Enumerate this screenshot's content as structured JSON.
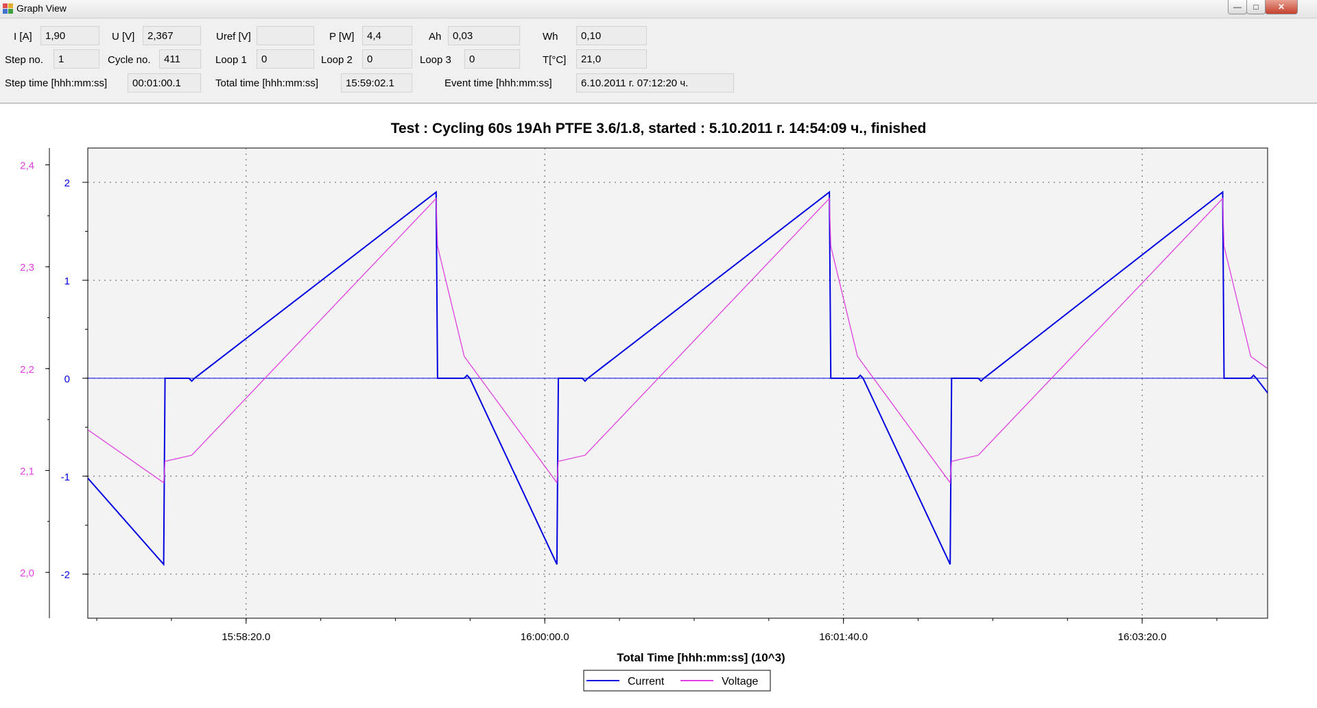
{
  "window": {
    "title": "Graph View",
    "icon": "graph-view-app-icon",
    "controls": {
      "minimize": "—",
      "maximize": "□",
      "close": "✕"
    }
  },
  "fields": {
    "current": {
      "label": "I [A]",
      "value": "1,90"
    },
    "voltage": {
      "label": "U [V]",
      "value": "2,367"
    },
    "uref": {
      "label": "Uref [V]",
      "value": ""
    },
    "power": {
      "label": "P [W]",
      "value": "4,4"
    },
    "ah": {
      "label": "Ah",
      "value": "0,03"
    },
    "wh": {
      "label": "Wh",
      "value": "0,10"
    },
    "step_no": {
      "label": "Step no.",
      "value": "1"
    },
    "cycle_no": {
      "label": "Cycle no.",
      "value": "411"
    },
    "loop1": {
      "label": "Loop 1",
      "value": "0"
    },
    "loop2": {
      "label": "Loop 2",
      "value": "0"
    },
    "loop3": {
      "label": "Loop 3",
      "value": "0"
    },
    "temperature": {
      "label": "T[°C]",
      "value": "21,0"
    },
    "step_time": {
      "label": "Step time [hhh:mm:ss]",
      "value": "00:01:00.1"
    },
    "total_time": {
      "label": "Total time [hhh:mm:ss]",
      "value": "15:59:02.1"
    },
    "event_time": {
      "label": "Event time [hhh:mm:ss]",
      "value": "6.10.2011 г. 07:12:20 ч."
    }
  },
  "chart_data": {
    "type": "line",
    "title": "Test : Cycling 60s 19Ah PTFE 3.6/1.8, started : 5.10.2011 г. 14:54:09 ч., finished",
    "xlabel": "Total Time [hhh:mm:ss] (10^3)",
    "x_ticks": [
      "15:58:20.0",
      "16:00:00.0",
      "16:01:40.0",
      "16:03:20.0"
    ],
    "x_tick_seconds": [
      57500,
      57600,
      57700,
      57800
    ],
    "xlim_seconds": [
      57447,
      57842
    ],
    "y_left_ticks": [
      "2,4",
      "2,3",
      "2,2",
      "2,1",
      "2,0"
    ],
    "y_left_values": [
      2.4,
      2.3,
      2.2,
      2.1,
      2.0
    ],
    "ylim_left": [
      1.955,
      2.4165
    ],
    "y_right_ticks": [
      "2",
      "1",
      "0",
      "-1",
      "-2"
    ],
    "y_right_values": [
      2,
      1,
      0,
      -1,
      -2
    ],
    "ylim_right": [
      -2.45,
      2.35
    ],
    "grid": true,
    "legend_position": "bottom-center",
    "zero_line_current": 0,
    "series": [
      {
        "name": "Current",
        "color": "#0000e0",
        "axis": "right",
        "points": [
          [
            57447,
            -1.02
          ],
          [
            57474,
            -1.9
          ],
          [
            57474.5,
            0
          ],
          [
            57483,
            0
          ],
          [
            57484,
            -0.03
          ],
          [
            57485,
            0
          ],
          [
            57571,
            1.9
          ],
          [
            57571.5,
            0
          ],
          [
            57581,
            0
          ],
          [
            57582,
            0.03
          ],
          [
            57583,
            0
          ],
          [
            57614,
            -1.9
          ],
          [
            57614.5,
            0
          ],
          [
            57623,
            0
          ],
          [
            57624,
            -0.03
          ],
          [
            57625,
            0
          ],
          [
            57711,
            1.9
          ],
          [
            57711.5,
            0
          ],
          [
            57721,
            0
          ],
          [
            57722,
            0.03
          ],
          [
            57723,
            0
          ],
          [
            57754,
            -1.9
          ],
          [
            57754.5,
            0
          ],
          [
            57764,
            0
          ],
          [
            57765,
            -0.03
          ],
          [
            57766,
            0
          ],
          [
            57851,
            1.9
          ],
          [
            57851.5,
            0
          ],
          [
            57861,
            0
          ],
          [
            57862,
            0.03
          ],
          [
            57863,
            0
          ],
          [
            57867,
            -0.15
          ]
        ],
        "x_offset_note": "shifted"
      },
      {
        "name": "Voltage",
        "color": "#e040e0",
        "axis": "left",
        "points": [
          [
            57447,
            2.14
          ],
          [
            57474,
            2.088
          ],
          [
            57474.5,
            2.109
          ],
          [
            57484,
            2.115
          ],
          [
            57571,
            2.367
          ],
          [
            57571.5,
            2.32
          ],
          [
            57581,
            2.212
          ],
          [
            57614,
            2.088
          ],
          [
            57614.5,
            2.109
          ],
          [
            57624,
            2.115
          ],
          [
            57711,
            2.367
          ],
          [
            57711.5,
            2.32
          ],
          [
            57721,
            2.212
          ],
          [
            57754,
            2.088
          ],
          [
            57754.5,
            2.109
          ],
          [
            57764,
            2.115
          ],
          [
            57851,
            2.367
          ],
          [
            57851.5,
            2.32
          ],
          [
            57861,
            2.212
          ],
          [
            57867,
            2.2
          ]
        ]
      }
    ]
  }
}
